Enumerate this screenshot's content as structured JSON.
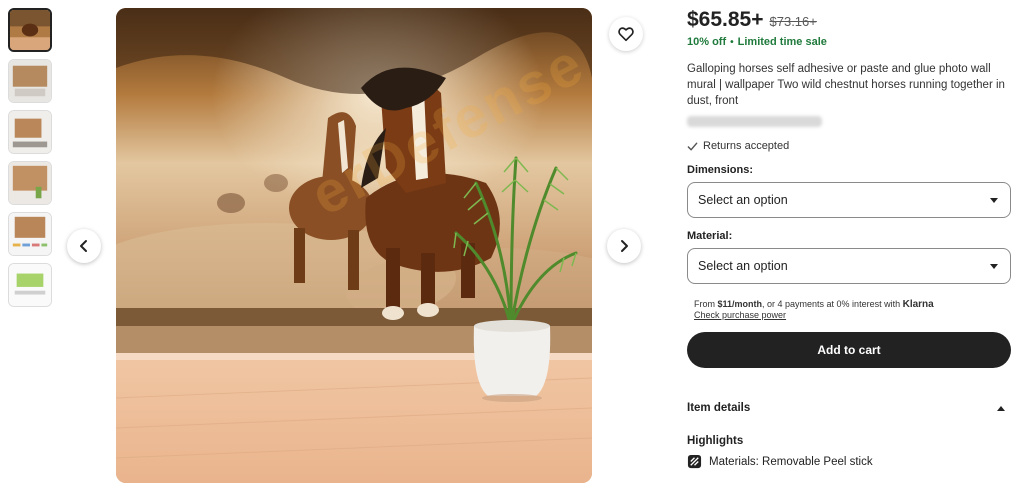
{
  "listing": {
    "price": "$65.85+",
    "original_price": "$73.16+",
    "discount": "10% off",
    "sale_separator": "•",
    "sale_label": "Limited time sale",
    "title": "Galloping horses self adhesive or paste and glue photo wall mural | wallpaper Two wild chestnut horses running together in dust, front",
    "returns": "Returns accepted"
  },
  "options": {
    "dimensions_label": "Dimensions:",
    "dimensions_value": "Select an option",
    "material_label": "Material:",
    "material_value": "Select an option"
  },
  "klarna": {
    "prefix": "From ",
    "amount": "$11/month",
    "middle": ", or 4 payments at 0% interest with ",
    "brand": "Klarna",
    "link": "Check purchase power"
  },
  "cart": {
    "label": "Add to cart"
  },
  "details": {
    "section_label": "Item details",
    "highlights_label": "Highlights",
    "material_text": "Materials: Removable Peel stick"
  },
  "watermark": {
    "text": "erDefense"
  },
  "icons": {
    "favorite": "heart-icon",
    "prev": "chevron-left-icon",
    "next": "chevron-right-icon",
    "returns": "checkmark-icon",
    "material": "material-icon",
    "details_toggle": "chevron-up-icon",
    "select_caret": "caret-down-icon"
  },
  "colors": {
    "sale_green": "#1f7a3c",
    "button_dark": "#222222",
    "watermark_orange": "#f5af3c"
  }
}
